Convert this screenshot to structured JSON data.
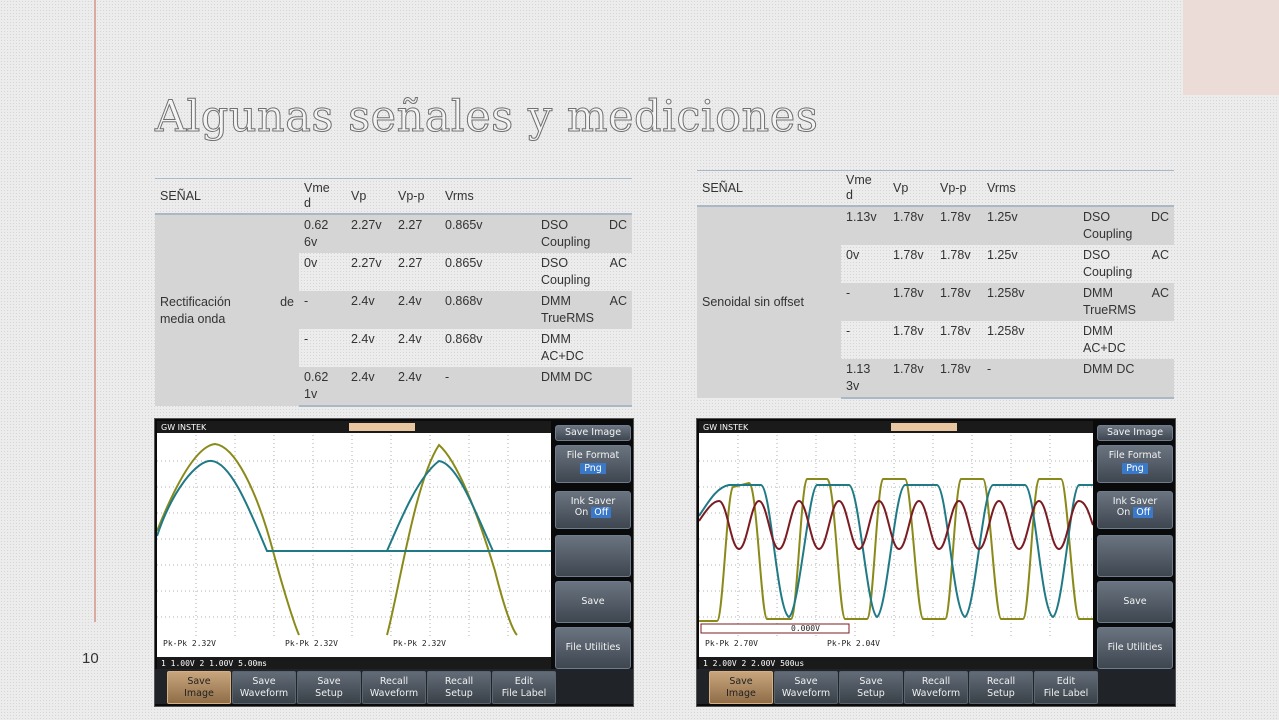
{
  "slide": {
    "title": "Algunas señales y mediciones",
    "page_number": "10"
  },
  "table_left": {
    "headers": [
      "SEÑAL",
      "Vmed",
      "Vp",
      "Vp-p",
      "Vrms",
      ""
    ],
    "signal_left": "Rectificación",
    "signal_right": "de",
    "signal_line2": "media onda",
    "rows": [
      {
        "vmed": "0.626v",
        "vp": "2.27v",
        "vpp": "2.27",
        "vrms": "0.865v",
        "note1": "DSO",
        "note1r": "DC",
        "note2": "Coupling"
      },
      {
        "vmed": "0v",
        "vp": "2.27v",
        "vpp": "2.27",
        "vrms": "0.865v",
        "note1": "DSO",
        "note1r": "AC",
        "note2": "Coupling"
      },
      {
        "vmed": "-",
        "vp": "2.4v",
        "vpp": "2.4v",
        "vrms": "0.868v",
        "note1": "DMM",
        "note1r": "AC",
        "note2": "TrueRMS"
      },
      {
        "vmed": "-",
        "vp": "2.4v",
        "vpp": "2.4v",
        "vrms": "0.868v",
        "note1": "DMM",
        "note1r": "",
        "note2": "AC+DC"
      },
      {
        "vmed": "0.621v",
        "vp": "2.4v",
        "vpp": "2.4v",
        "vrms": "-",
        "note1": "DMM DC",
        "note1r": "",
        "note2": ""
      }
    ]
  },
  "table_right": {
    "headers": [
      "SEÑAL",
      "Vmed",
      "Vp",
      "Vp-p",
      "Vrms",
      ""
    ],
    "signal": "Senoidal sin offset",
    "rows": [
      {
        "vmed": "1.13v",
        "vp": "1.78v",
        "vpp": "1.78v",
        "vrms": "1.25v",
        "note1": "DSO",
        "note1r": "DC",
        "note2": "Coupling"
      },
      {
        "vmed": "0v",
        "vp": "1.78v",
        "vpp": "1.78v",
        "vrms": "1.25v",
        "note1": "DSO",
        "note1r": "AC",
        "note2": "Coupling"
      },
      {
        "vmed": "-",
        "vp": "1.78v",
        "vpp": "1.78v",
        "vrms": "1.258v",
        "note1": "DMM",
        "note1r": "AC",
        "note2": "TrueRMS"
      },
      {
        "vmed": "-",
        "vp": "1.78v",
        "vpp": "1.78v",
        "vrms": "1.258v",
        "note1": "DMM",
        "note1r": "",
        "note2": "AC+DC"
      },
      {
        "vmed": "1.133v",
        "vp": "1.78v",
        "vpp": "1.78v",
        "vrms": "-",
        "note1": "DMM DC",
        "note1r": "",
        "note2": ""
      }
    ]
  },
  "scope_common": {
    "brand": "GW INSTEK",
    "side": {
      "save_image": "Save Image",
      "file_format": "File Format",
      "file_format_value": "Png",
      "ink_saver": "Ink Saver",
      "ink_on": "On",
      "ink_off": "Off",
      "save": "Save",
      "file_utilities": "File Utilities"
    },
    "bottom": [
      "Save\nImage",
      "Save\nWaveform",
      "Save\nSetup",
      "Recall\nWaveform",
      "Recall\nSetup",
      "Edit\nFile Label"
    ]
  },
  "scope_left": {
    "meas": [
      "Pk-Pk 2.32V",
      "Pk-Pk 2.32V",
      "Pk-Pk 2.32V"
    ],
    "status": "1 1.00V  2 1.00V  5.00ms"
  },
  "scope_right": {
    "meas": [
      "Pk-Pk 2.70V",
      "Pk-Pk 2.04V"
    ],
    "status": "1 2.00V  2 2.00V  500us",
    "marker": "0.000V"
  },
  "colors": {
    "ch1": "#8a8a1a",
    "ch2": "#1f7a86",
    "ref": "#7a1c22",
    "table_border": "#aab7c4",
    "row_band": "#d5d5d5"
  }
}
